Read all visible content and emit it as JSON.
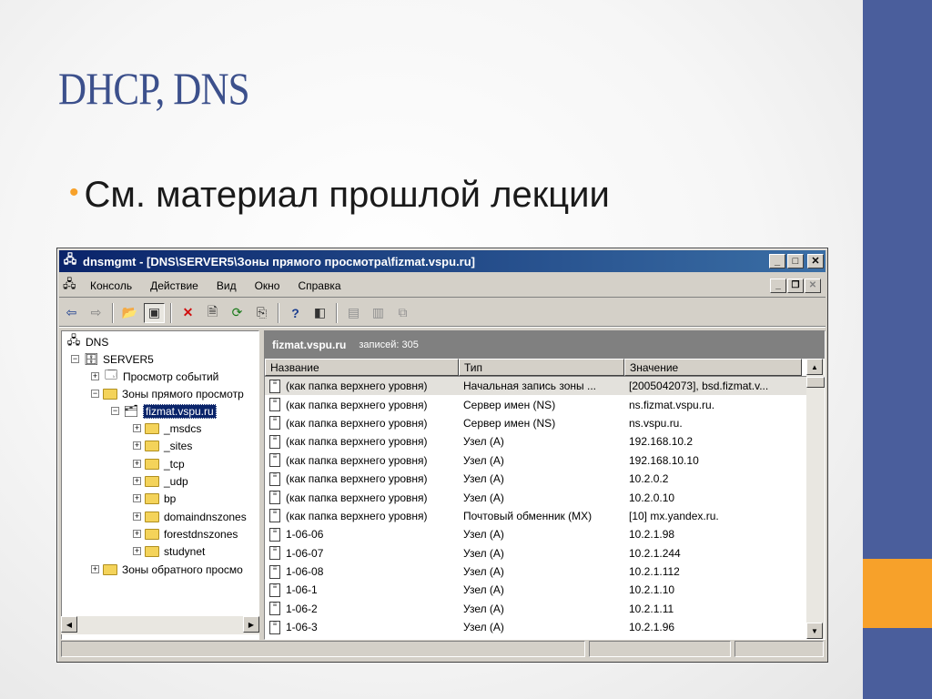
{
  "slide": {
    "title": "DHCP, DNS",
    "bullet": "См. материал прошлой лекции",
    "colors": {
      "title": "#3c508c",
      "accent_blue": "#4a5e9c",
      "accent_orange": "#f7a12a"
    }
  },
  "window": {
    "title": "dnsmgmt - [DNS\\SERVER5\\Зоны прямого просмотра\\fizmat.vspu.ru]",
    "caption_buttons": [
      "minimize",
      "maximize",
      "close"
    ],
    "menu": [
      "Консоль",
      "Действие",
      "Вид",
      "Окно",
      "Справка"
    ],
    "toolbar_icons": [
      "back-arrow-icon",
      "forward-arrow-icon",
      "up-folder-icon",
      "show-hide-tree-icon",
      "delete-icon",
      "properties-icon",
      "refresh-icon",
      "export-icon",
      "help-icon",
      "console-tree-icon",
      "new-record-icon",
      "new-domain-icon",
      "new-delegation-icon"
    ]
  },
  "tree": {
    "nodes": [
      {
        "label": "DNS",
        "icon": "dns-icon",
        "toggle": ""
      },
      {
        "label": "SERVER5",
        "icon": "server-icon",
        "toggle": "−"
      },
      {
        "label": "Просмотр событий",
        "icon": "event-viewer-icon",
        "toggle": "+"
      },
      {
        "label": "Зоны прямого просмотр",
        "icon": "folder-icon",
        "toggle": "−"
      },
      {
        "label": "fizmat.vspu.ru",
        "icon": "zone-icon",
        "toggle": "−",
        "selected": true
      },
      {
        "label": "_msdcs",
        "icon": "folder-icon",
        "toggle": "+"
      },
      {
        "label": "_sites",
        "icon": "folder-icon",
        "toggle": "+"
      },
      {
        "label": "_tcp",
        "icon": "folder-icon",
        "toggle": "+"
      },
      {
        "label": "_udp",
        "icon": "folder-icon",
        "toggle": "+"
      },
      {
        "label": "bp",
        "icon": "folder-icon",
        "toggle": "+"
      },
      {
        "label": "domaindnszones",
        "icon": "folder-icon",
        "toggle": "+"
      },
      {
        "label": "forestdnszones",
        "icon": "folder-icon",
        "toggle": "+"
      },
      {
        "label": "studynet",
        "icon": "folder-icon",
        "toggle": "+"
      },
      {
        "label": "Зоны обратного просмо",
        "icon": "folder-icon",
        "toggle": "+"
      }
    ]
  },
  "details": {
    "zone_name": "fizmat.vspu.ru",
    "record_count": "записей: 305",
    "columns": [
      "Название",
      "Тип",
      "Значение"
    ],
    "rows": [
      [
        "(как папка верхнего уровня)",
        "Начальная запись зоны ...",
        "[2005042073], bsd.fizmat.v..."
      ],
      [
        "(как папка верхнего уровня)",
        "Сервер имен (NS)",
        "ns.fizmat.vspu.ru."
      ],
      [
        "(как папка верхнего уровня)",
        "Сервер имен (NS)",
        "ns.vspu.ru."
      ],
      [
        "(как папка верхнего уровня)",
        "Узел (A)",
        "192.168.10.2"
      ],
      [
        "(как папка верхнего уровня)",
        "Узел (A)",
        "192.168.10.10"
      ],
      [
        "(как папка верхнего уровня)",
        "Узел (A)",
        "10.2.0.2"
      ],
      [
        "(как папка верхнего уровня)",
        "Узел (A)",
        "10.2.0.10"
      ],
      [
        "(как папка верхнего уровня)",
        "Почтовый обменник (MX)",
        "[10]  mx.yandex.ru."
      ],
      [
        "1-06-06",
        "Узел (A)",
        "10.2.1.98"
      ],
      [
        "1-06-07",
        "Узел (A)",
        "10.2.1.244"
      ],
      [
        "1-06-08",
        "Узел (A)",
        "10.2.1.112"
      ],
      [
        "1-06-1",
        "Узел (A)",
        "10.2.1.10"
      ],
      [
        "1-06-2",
        "Узел (A)",
        "10.2.1.11"
      ],
      [
        "1-06-3",
        "Узел (A)",
        "10.2.1.96"
      ]
    ]
  }
}
